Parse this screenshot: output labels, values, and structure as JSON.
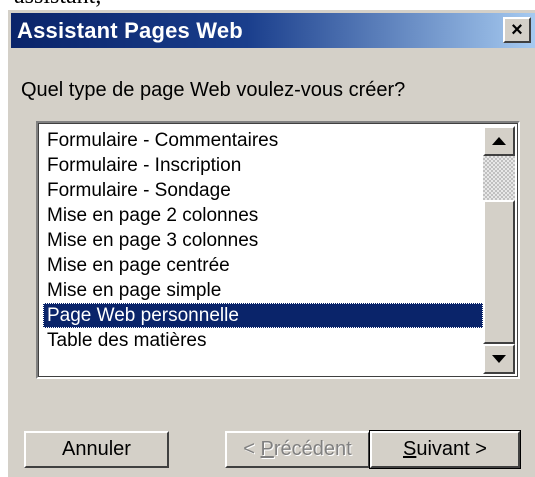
{
  "caption_fragment": "assistant,",
  "dialog": {
    "title": "Assistant Pages Web",
    "close_label": "×",
    "question": "Quel type de page Web voulez-vous créer?"
  },
  "list": {
    "items": [
      "Formulaire - Commentaires",
      "Formulaire - Inscription",
      "Formulaire - Sondage",
      "Mise en page 2 colonnes",
      "Mise en page 3 colonnes",
      "Mise en page centrée",
      "Mise en page simple",
      "Page Web personnelle",
      "Table des matières"
    ],
    "selected_index": 7
  },
  "buttons": {
    "cancel": "Annuler",
    "back_prefix": "< ",
    "back_mnemonic": "P",
    "back_rest": "récédent",
    "next_mnemonic": "S",
    "next_rest": "uivant >"
  },
  "colors": {
    "title_bar": "#0a246a",
    "selection": "#0a246a",
    "face": "#d4d0c8"
  },
  "icons": {
    "close": "close-icon",
    "scroll_up": "arrow-up-icon",
    "scroll_down": "arrow-down-icon"
  }
}
